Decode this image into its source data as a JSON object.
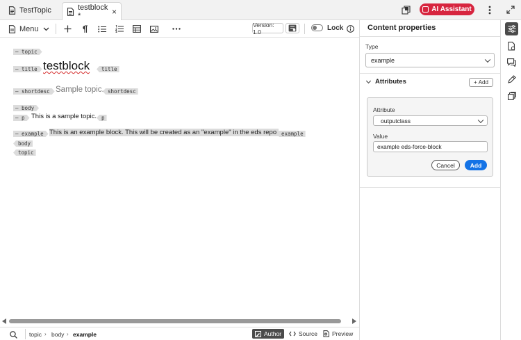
{
  "tabs": [
    {
      "label": "TestTopic",
      "icon": "document-icon",
      "active": false
    },
    {
      "label": "testblock *",
      "icon": "document-icon",
      "active": true,
      "close": "×"
    }
  ],
  "topbar": {
    "ai_assistant_label": "AI Assistant",
    "accent": "#d7253f"
  },
  "toolbar": {
    "menu_label": "Menu",
    "version_label": "Version: 1.0",
    "lock_label": "Lock",
    "icons": [
      "insert-element-icon",
      "pilcrow-icon",
      "bulleted-list-icon",
      "numbered-list-icon",
      "table-icon",
      "image-icon",
      "more-icon",
      "version-history-icon",
      "info-icon"
    ]
  },
  "editor": {
    "lines": [
      {
        "tag": "topic"
      },
      {
        "tag": "title",
        "text": "testblock",
        "close_tag": "title"
      },
      {
        "tag": "shortdesc",
        "text": "Sample topic.",
        "close_tag": "shortdesc"
      },
      {
        "tag": "body"
      },
      {
        "tag": "p",
        "text": "This is a sample topic.",
        "close_tag": "p"
      },
      {
        "tag": "example",
        "text": "This is an example block. This will be created as an \"example\" in the eds repo.",
        "close_tag": "example"
      },
      {
        "close_tag": "body"
      },
      {
        "close_tag": "topic"
      }
    ]
  },
  "statusbar": {
    "breadcrumb": [
      "topic",
      "body",
      "example"
    ],
    "modes": [
      {
        "label": "Author",
        "active": true
      },
      {
        "label": "Source",
        "active": false
      },
      {
        "label": "Preview",
        "active": false
      }
    ]
  },
  "panel": {
    "title": "Content properties",
    "type_label": "Type",
    "type_value": "example",
    "attributes_label": "Attributes",
    "add_label": "Add",
    "attribute_label": "Attribute",
    "attribute_value": "outputclass",
    "value_label": "Value",
    "value_value": "example eds-force-block",
    "cancel_label": "Cancel",
    "add_button_label": "Add",
    "primary_color": "#1473e6"
  },
  "rail": {
    "icons": [
      "content-properties-icon",
      "file-properties-icon",
      "comments-icon",
      "edit-icon",
      "versions-icon"
    ]
  }
}
